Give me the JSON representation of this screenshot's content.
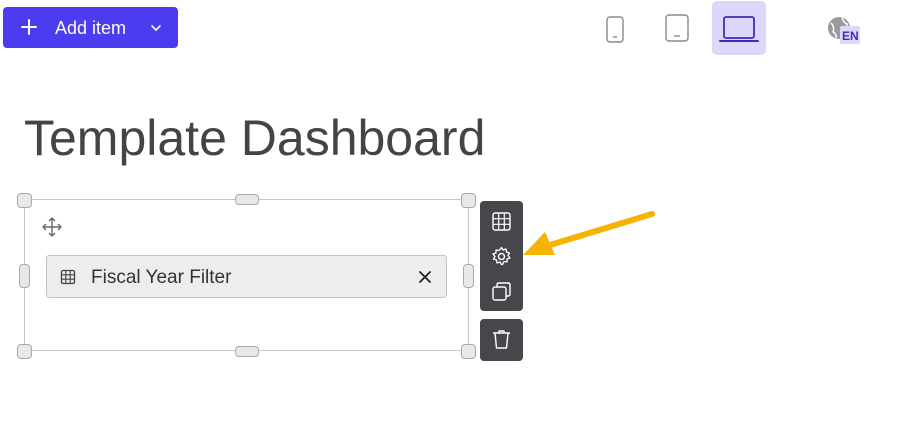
{
  "toolbar": {
    "add_label": "Add item"
  },
  "devices": [
    {
      "name": "phone-view",
      "active": false
    },
    {
      "name": "tablet-view",
      "active": false
    },
    {
      "name": "laptop-view",
      "active": true
    }
  ],
  "language": {
    "code": "EN"
  },
  "page": {
    "title": "Template Dashboard"
  },
  "widget": {
    "filter_label": "Fiscal Year Filter"
  },
  "widget_toolbar": {
    "actions": [
      "table-icon",
      "gear-icon",
      "duplicate-icon",
      "trash-icon"
    ]
  },
  "colors": {
    "accent": "#4b3cf0",
    "active_device_bg": "#ddd7fb",
    "toolbar_bg": "#46464b",
    "annotation_arrow": "#f5b400"
  }
}
